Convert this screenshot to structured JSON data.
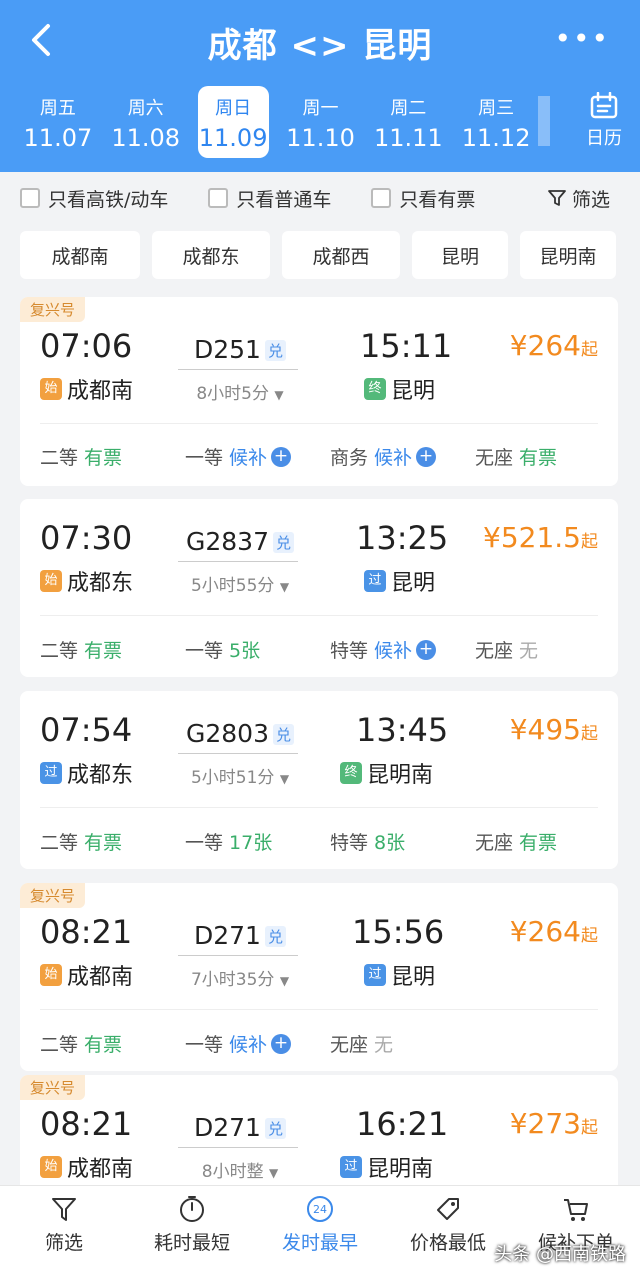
{
  "header": {
    "title": "成都 <> 昆明",
    "more": "•••",
    "dates": [
      {
        "weekday": "周五",
        "date": "11.07"
      },
      {
        "weekday": "周六",
        "date": "11.08"
      },
      {
        "weekday": "周日",
        "date": "11.09"
      },
      {
        "weekday": "周一",
        "date": "11.10"
      },
      {
        "weekday": "周二",
        "date": "11.11"
      },
      {
        "weekday": "周三",
        "date": "11.12"
      }
    ],
    "selected_index": 2,
    "calendar_label": "日历"
  },
  "filters": {
    "high_speed": "只看高铁/动车",
    "regular": "只看普通车",
    "available": "只看有票",
    "filter_btn": "筛选"
  },
  "stations": [
    "成都南",
    "成都东",
    "成都西",
    "昆明",
    "昆明南"
  ],
  "trains": [
    {
      "tag": "复兴号",
      "dep_time": "07:06",
      "train_no": "D251",
      "dui": "兑",
      "arr_time": "15:11",
      "duration": "8小时5分",
      "price": "¥264",
      "price_suffix": "起",
      "from_badge": "始",
      "from": "成都南",
      "to_badge": "终",
      "to": "昆明",
      "seats": [
        {
          "name": "二等",
          "status": "有票",
          "kind": "avail"
        },
        {
          "name": "一等",
          "status": "候补",
          "kind": "wait"
        },
        {
          "name": "商务",
          "status": "候补",
          "kind": "wait"
        },
        {
          "name": "无座",
          "status": "有票",
          "kind": "avail"
        }
      ]
    },
    {
      "tag": "",
      "dep_time": "07:30",
      "train_no": "G2837",
      "dui": "兑",
      "arr_time": "13:25",
      "duration": "5小时55分",
      "price": "¥521.5",
      "price_suffix": "起",
      "from_badge": "始",
      "from": "成都东",
      "to_badge": "过",
      "to": "昆明",
      "seats": [
        {
          "name": "二等",
          "status": "有票",
          "kind": "avail"
        },
        {
          "name": "一等",
          "status": "5张",
          "kind": "avail"
        },
        {
          "name": "特等",
          "status": "候补",
          "kind": "wait"
        },
        {
          "name": "无座",
          "status": "无",
          "kind": "none"
        }
      ]
    },
    {
      "tag": "",
      "dep_time": "07:54",
      "train_no": "G2803",
      "dui": "兑",
      "arr_time": "13:45",
      "duration": "5小时51分",
      "price": "¥495",
      "price_suffix": "起",
      "from_badge": "过",
      "from": "成都东",
      "to_badge": "终",
      "to": "昆明南",
      "seats": [
        {
          "name": "二等",
          "status": "有票",
          "kind": "avail"
        },
        {
          "name": "一等",
          "status": "17张",
          "kind": "avail"
        },
        {
          "name": "特等",
          "status": "8张",
          "kind": "avail"
        },
        {
          "name": "无座",
          "status": "有票",
          "kind": "avail"
        }
      ]
    },
    {
      "tag": "复兴号",
      "dep_time": "08:21",
      "train_no": "D271",
      "dui": "兑",
      "arr_time": "15:56",
      "duration": "7小时35分",
      "price": "¥264",
      "price_suffix": "起",
      "from_badge": "始",
      "from": "成都南",
      "to_badge": "过",
      "to": "昆明",
      "seats": [
        {
          "name": "二等",
          "status": "有票",
          "kind": "avail"
        },
        {
          "name": "一等",
          "status": "候补",
          "kind": "wait"
        },
        {
          "name": "无座",
          "status": "无",
          "kind": "none"
        }
      ]
    },
    {
      "tag": "复兴号",
      "dep_time": "08:21",
      "train_no": "D271",
      "dui": "兑",
      "arr_time": "16:21",
      "duration": "8小时整",
      "price": "¥273",
      "price_suffix": "起",
      "from_badge": "始",
      "from": "成都南",
      "to_badge": "过",
      "to": "昆明南",
      "seats": []
    }
  ],
  "bottom": {
    "filter": "筛选",
    "shortest": "耗时最短",
    "earliest": "发时最早",
    "earliest_icon_text": "24",
    "lowest": "价格最低",
    "waitlist": "候补下单"
  },
  "watermark": "头条 @西南铁路"
}
